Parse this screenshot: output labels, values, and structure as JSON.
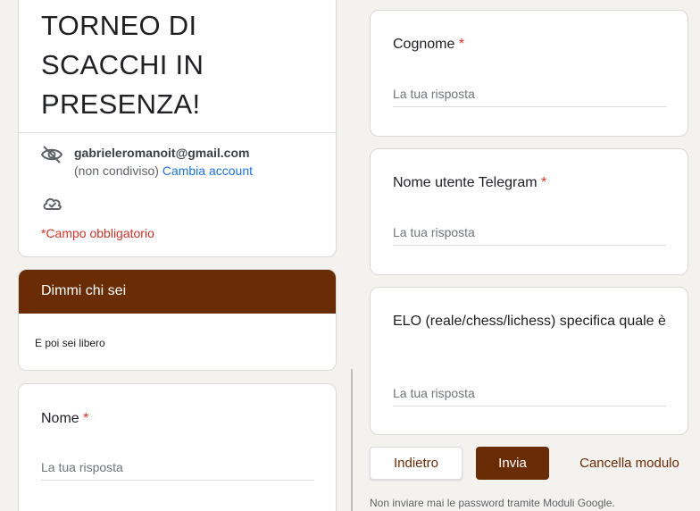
{
  "header": {
    "title": "TORNEO DI SCACCHI IN PRESENZA!",
    "account_email": "gabrieleromanoit@gmail.com",
    "account_status": "(non condiviso)",
    "switch_account": "Cambia account",
    "required_note": "*Campo obbligatorio",
    "icons": [
      "eye-off-icon",
      "cloud-check-icon"
    ]
  },
  "section": {
    "title": "Dimmi chi sei",
    "description": "E poi sei libero"
  },
  "questions": [
    {
      "label": "Nome",
      "required": "*",
      "placeholder": "La tua risposta"
    },
    {
      "label": "Cognome",
      "required": "*",
      "placeholder": "La tua risposta"
    },
    {
      "label": "Nome utente Telegram",
      "required": "*",
      "placeholder": "La tua risposta"
    },
    {
      "label": "ELO (reale/chess/lichess) specifica quale è",
      "required": "",
      "placeholder": "La tua risposta"
    }
  ],
  "actions": {
    "back": "Indietro",
    "submit": "Invia",
    "clear": "Cancella modulo"
  },
  "footer": {
    "note": "Non inviare mai le password tramite Moduli Google."
  },
  "colors": {
    "accent": "#6a2c05",
    "required": "#d93025",
    "link": "#1a73e8",
    "background": "#f4f2ee"
  }
}
